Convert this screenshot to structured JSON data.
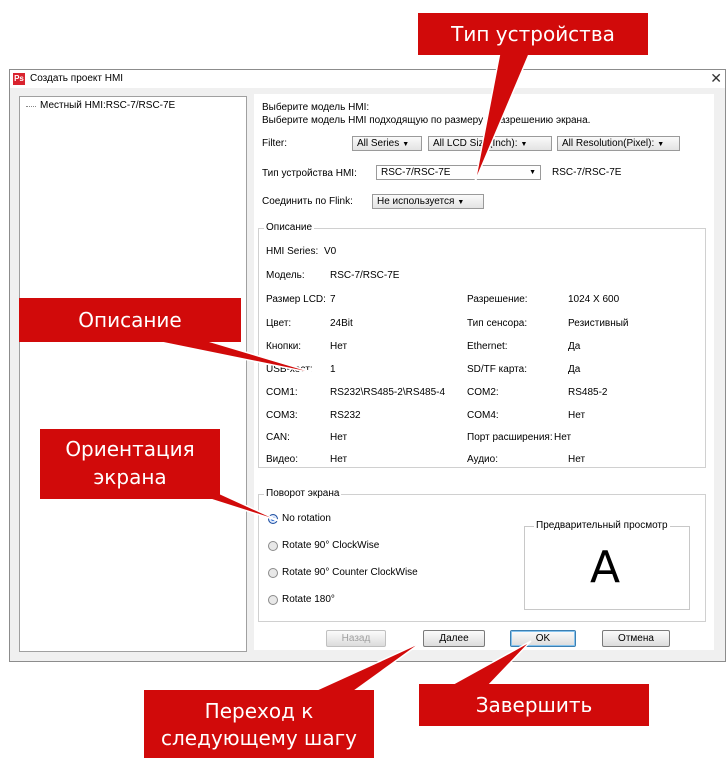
{
  "window": {
    "app_icon": "Ps",
    "title": "Создать проект HMI",
    "close_glyph": "✕"
  },
  "tree": {
    "item": "Местный HMI:RSC-7/RSC-7E"
  },
  "header": {
    "line1": "Выберите модель HMI:",
    "line2": "Выберите модель HMI подходящую по размеру и разрешению экрана."
  },
  "filter": {
    "label": "Filter:",
    "series": "All Series",
    "lcd_size": "All LCD Size(Inch):",
    "resolution": "All Resolution(Pixel):"
  },
  "device_type": {
    "label": "Тип устройства HMI:",
    "value": "RSC-7/RSC-7E",
    "display": "RSC-7/RSC-7E"
  },
  "flink": {
    "label": "Соединить по Flink:",
    "value": "Не используется"
  },
  "description": {
    "title": "Описание",
    "series_label": "HMI Series:",
    "series_value": "V0",
    "model_label": "Модель:",
    "model_value": "RSC-7/RSC-7E",
    "lcd_label": "Размер LCD:",
    "lcd_value": "7",
    "resolution_label": "Разрешение:",
    "resolution_value": "1024 X 600",
    "color_label": "Цвет:",
    "color_value": "24Bit",
    "sensor_label": "Тип сенсора:",
    "sensor_value": "Резистивный",
    "buttons_label": "Кнопки:",
    "buttons_value": "Нет",
    "ethernet_label": "Ethernet:",
    "ethernet_value": "Да",
    "usb_label": "USB-хост:",
    "usb_value": "1",
    "sd_label": "SD/TF карта:",
    "sd_value": "Да",
    "com1_label": "COM1:",
    "com1_value": "RS232\\RS485-2\\RS485-4",
    "com2_label": "COM2:",
    "com2_value": "RS485-2",
    "com3_label": "COM3:",
    "com3_value": "RS232",
    "com4_label": "COM4:",
    "com4_value": "Нет",
    "can_label": "CAN:",
    "can_value": "Нет",
    "port_label": "Порт расширения:",
    "port_value": "Нет",
    "video_label": "Видео:",
    "video_value": "Нет",
    "audio_label": "Аудио:",
    "audio_value": "Нет"
  },
  "rotation": {
    "title": "Поворот экрана",
    "options": [
      "No rotation",
      "Rotate 90° ClockWise",
      "Rotate 90° Counter ClockWise",
      "Rotate 180°"
    ],
    "selected_index": 0,
    "preview_title": "Предварительный просмотр",
    "preview_letter": "A"
  },
  "buttons": {
    "back": "Назад",
    "next": "Далее",
    "ok": "OK",
    "cancel": "Отмена"
  },
  "callouts": {
    "device_type": "Тип устройства",
    "description": "Описание",
    "orientation_line1": "Ориентация",
    "orientation_line2": "экрана",
    "next_line1": "Переход к",
    "next_line2": "следующему шагу",
    "finish": "Завершить"
  },
  "colors": {
    "callout_red": "#d10a0a",
    "selected_radio": "#2f6fd6"
  }
}
